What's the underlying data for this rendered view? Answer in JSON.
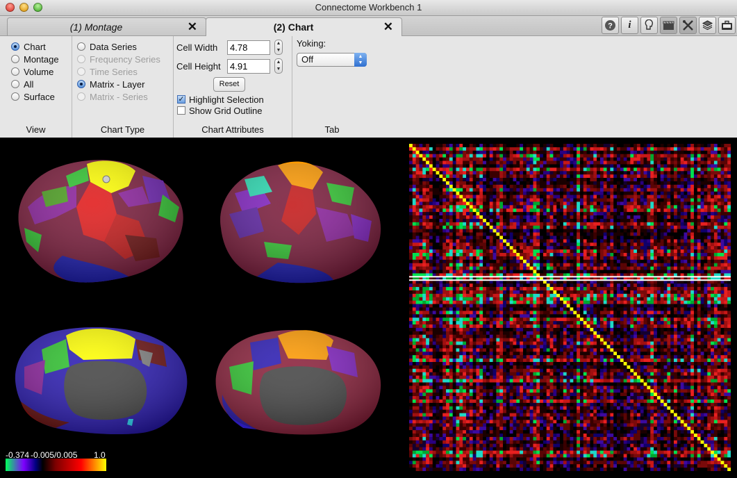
{
  "window": {
    "title": "Connectome Workbench 1"
  },
  "tabs": [
    {
      "label": "(1) Montage",
      "close_icon": "close-x"
    },
    {
      "label": "(2) Chart",
      "close_icon": "close-x"
    }
  ],
  "toolbar_icons": [
    "help-icon",
    "info-icon",
    "identify-icon",
    "movie-icon",
    "tools-icon",
    "layers-icon",
    "briefcase-icon"
  ],
  "view": {
    "title": "View",
    "options": [
      "Chart",
      "Montage",
      "Volume",
      "All",
      "Surface"
    ],
    "selected": "Chart"
  },
  "chart_type": {
    "title": "Chart Type",
    "options": [
      "Data Series",
      "Frequency Series",
      "Time Series",
      "Matrix - Layer",
      "Matrix - Series"
    ],
    "disabled": [
      "Frequency Series",
      "Time Series",
      "Matrix - Series"
    ],
    "selected": "Matrix - Layer"
  },
  "chart_attributes": {
    "title": "Chart Attributes",
    "cell_width_label": "Cell Width",
    "cell_width": "4.78",
    "cell_height_label": "Cell Height",
    "cell_height": "4.91",
    "reset_label": "Reset",
    "highlight_label": "Highlight Selection",
    "highlight_checked": true,
    "grid_label": "Show Grid Outline",
    "grid_checked": false
  },
  "tab_group": {
    "title": "Tab",
    "yoking_label": "Yoking:",
    "yoking_value": "Off"
  },
  "palette": {
    "min_label": "-0.374",
    "mid_label": "-0.005/0.005",
    "max_label": "1.0",
    "colors": [
      "#00ff5a",
      "#7f00ff",
      "#00007f",
      "#000000",
      "#7f0000",
      "#ff0000",
      "#ffff00"
    ]
  },
  "matrix": {
    "highlighted_row": 39,
    "diagonal_color": "#ffff00",
    "highlight_color": "#ffffff"
  }
}
